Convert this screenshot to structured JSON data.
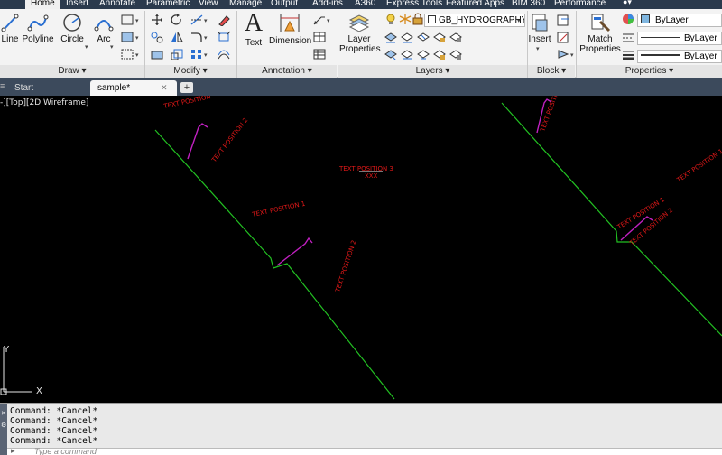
{
  "ribbon_tabs": [
    "Home",
    "Insert",
    "Annotate",
    "Parametric",
    "View",
    "Manage",
    "Output",
    "Add-ins",
    "A360",
    "Express Tools",
    "Featured Apps",
    "BIM 360",
    "Performance"
  ],
  "active_tab": "Home",
  "panels": {
    "draw": {
      "title": "Draw",
      "line": "Line",
      "polyline": "Polyline",
      "circle": "Circle",
      "arc": "Arc"
    },
    "modify": {
      "title": "Modify"
    },
    "annotation": {
      "title": "Annotation",
      "text": "Text",
      "dimension": "Dimension"
    },
    "layers": {
      "title": "Layers",
      "layer_properties_line1": "Layer",
      "layer_properties_line2": "Properties",
      "current_layer": "GB_HYDROGRAPHY"
    },
    "block": {
      "title": "Block",
      "insert": "Insert"
    },
    "properties": {
      "title": "Properties",
      "match_line1": "Match",
      "match_line2": "Properties",
      "color": "ByLayer",
      "linetype": "ByLayer",
      "lineweight": "ByLayer"
    }
  },
  "doc_tabs": {
    "start": "Start",
    "file": "sample*",
    "close": "✕",
    "new": "+"
  },
  "viewport": {
    "label": "-][Top][2D Wireframe]"
  },
  "drawing_text": {
    "tp_top": "TEXT POSITION",
    "tp2_left": "TEXT POSITION 2",
    "tp1_left": "TEXT POSITION 1",
    "tp2_mid": "TEXT POSITION 2",
    "tp3": "TEXT POSITION 3",
    "xxx": "XXX",
    "tp1_right": "TEXT POSITION 1",
    "tp2_right": "TEXT POSITION 2",
    "tp_right_top": "TEXT POSITION 3",
    "tp_far_right": "TEXT POSITION 1 2"
  },
  "ucs": {
    "y": "Y",
    "x": "X"
  },
  "command_history": [
    "Command: *Cancel*",
    "Command: *Cancel*",
    "Command: *Cancel*",
    "Command: *Cancel*"
  ],
  "command_input": {
    "placeholder": "Type a command"
  },
  "colors": {
    "canvas": "#000000",
    "green_line": "#22c022",
    "red_text": "#e01818",
    "magenta": "#c020c0",
    "ribbon_bg": "#f3f3f3"
  }
}
